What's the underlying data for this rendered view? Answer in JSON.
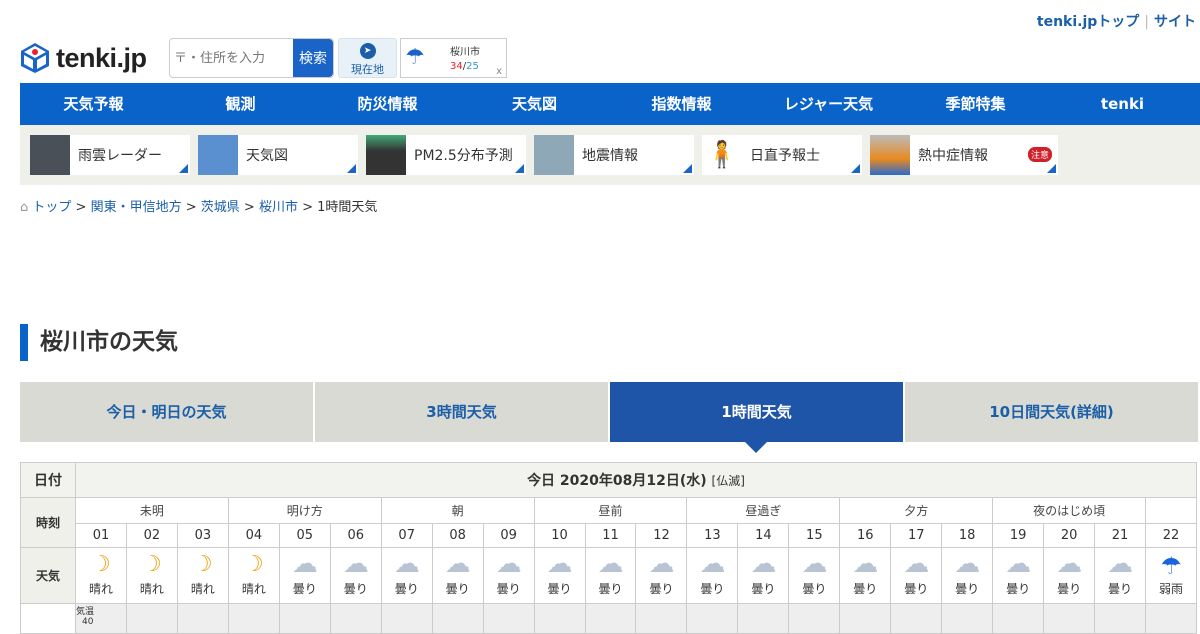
{
  "header": {
    "links": [
      "tenki.jpトップ",
      "サイト"
    ],
    "logo": "tenki.jp",
    "search_placeholder": "〒・住所を入力",
    "search_button": "検索",
    "here_label": "現在地",
    "saved_location": {
      "name": "桜川市",
      "high": "34",
      "low": "25",
      "close": "x"
    }
  },
  "nav": [
    "天気予報",
    "観測",
    "防災情報",
    "天気図",
    "指数情報",
    "レジャー天気",
    "季節特集",
    "tenki"
  ],
  "shortcuts": [
    {
      "label": "雨雲レーダー"
    },
    {
      "label": "天気図"
    },
    {
      "label": "PM2.5分布予測"
    },
    {
      "label": "地震情報"
    },
    {
      "label": "日直予報士"
    },
    {
      "label": "熱中症情報",
      "badge": "注意"
    }
  ],
  "breadcrumb": [
    "トップ",
    "関東・甲信地方",
    "茨城県",
    "桜川市",
    "1時間天気"
  ],
  "page_title": "桜川市の天気",
  "tabs": [
    "今日・明日の天気",
    "3時間天気",
    "1時間天気",
    "10日間天気(詳細)"
  ],
  "table": {
    "date_label": "日付",
    "date": "今日 2020年08月12日(水)",
    "rokuyo": "[仏滅]",
    "time_label": "時刻",
    "weather_label": "天気",
    "temp_label": "気温",
    "temp_axis": "40",
    "segments": [
      "未明",
      "明け方",
      "朝",
      "昼前",
      "昼過ぎ",
      "夕方",
      "夜のはじめ頃",
      ""
    ],
    "hours": [
      "01",
      "02",
      "03",
      "04",
      "05",
      "06",
      "07",
      "08",
      "09",
      "10",
      "11",
      "12",
      "13",
      "14",
      "15",
      "16",
      "17",
      "18",
      "19",
      "20",
      "21",
      "22"
    ],
    "weather": [
      "晴れ",
      "晴れ",
      "晴れ",
      "晴れ",
      "曇り",
      "曇り",
      "曇り",
      "曇り",
      "曇り",
      "曇り",
      "曇り",
      "曇り",
      "曇り",
      "曇り",
      "曇り",
      "曇り",
      "曇り",
      "曇り",
      "曇り",
      "曇り",
      "曇り",
      "弱雨"
    ]
  },
  "colors": {
    "brand": "#0a63c9",
    "high": "#e8202a",
    "low": "#2a9ad8"
  }
}
